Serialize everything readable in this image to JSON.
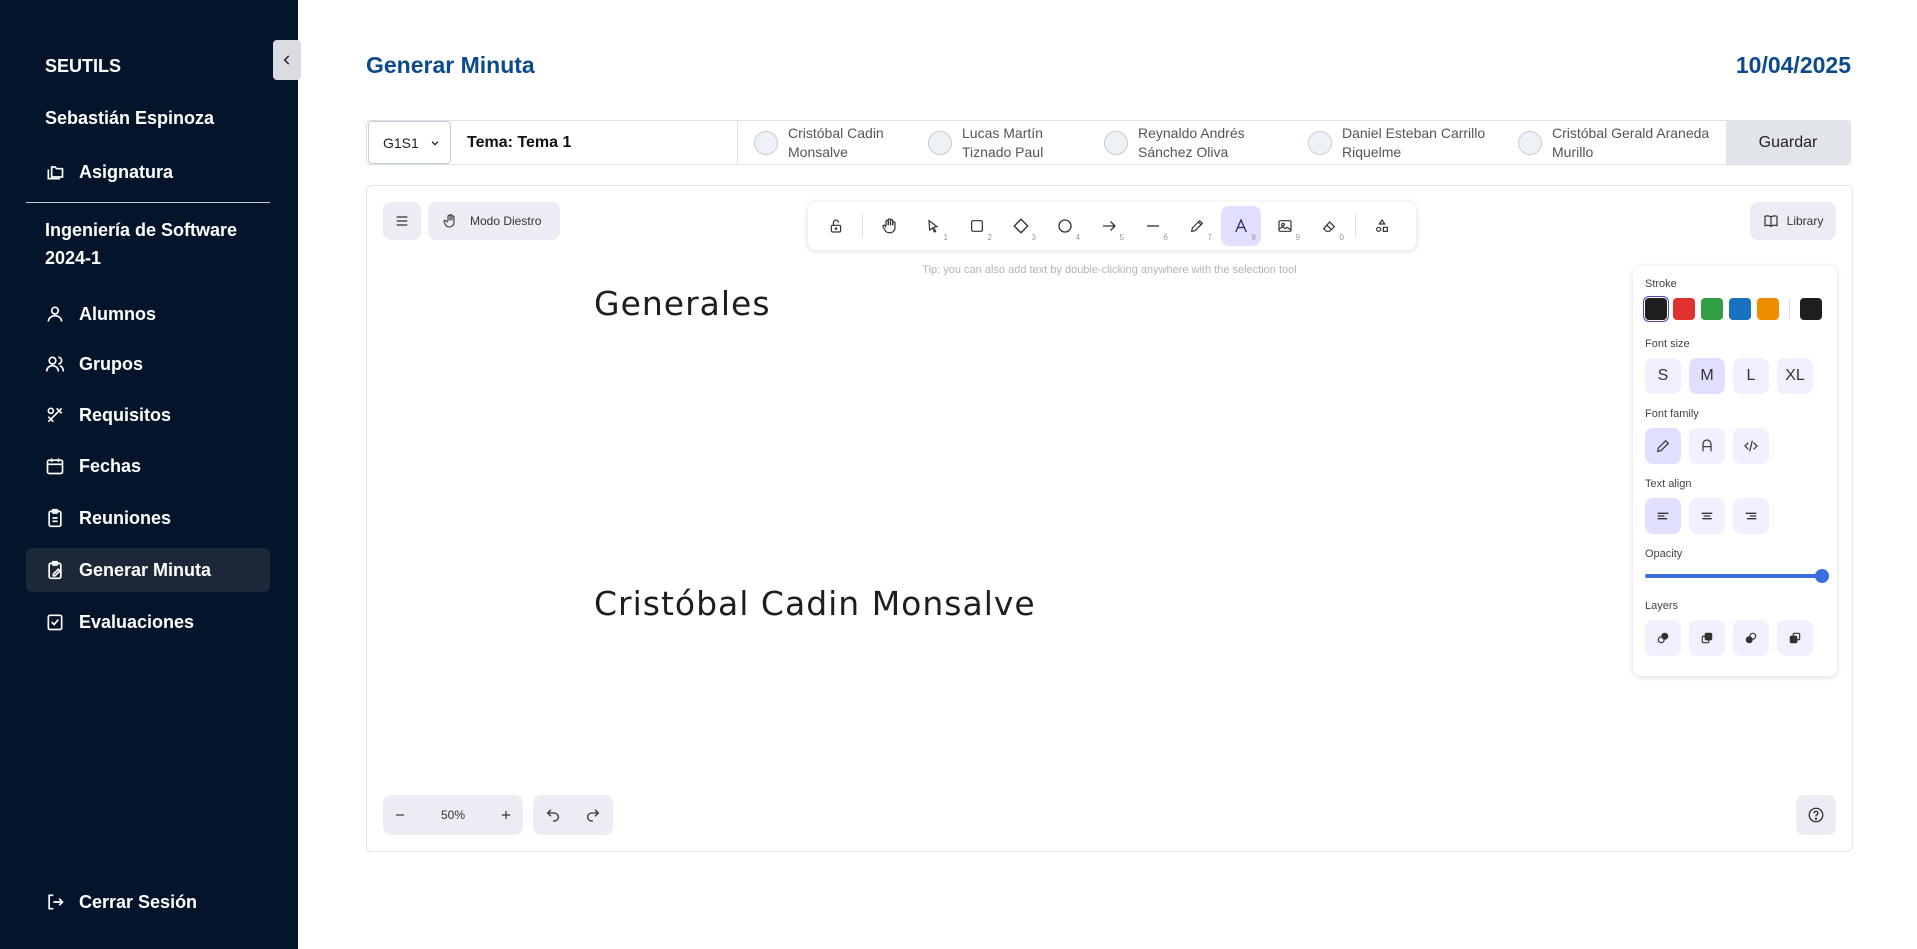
{
  "sidebar": {
    "brand": "SEUTILS",
    "user": "Sebastián Espinoza",
    "subject_label": "Asignatura",
    "course": "Ingeniería de Software 2024-1",
    "items": [
      {
        "label": "Alumnos",
        "icon": "user-icon"
      },
      {
        "label": "Grupos",
        "icon": "users-icon"
      },
      {
        "label": "Requisitos",
        "icon": "tools-icon"
      },
      {
        "label": "Fechas",
        "icon": "calendar-icon"
      },
      {
        "label": "Reuniones",
        "icon": "clipboard-icon"
      },
      {
        "label": "Generar Minuta",
        "icon": "clipboard-edit-icon",
        "active": true
      },
      {
        "label": "Evaluaciones",
        "icon": "check-square-icon"
      }
    ],
    "logout": "Cerrar Sesión"
  },
  "header": {
    "title": "Generar Minuta",
    "date": "10/04/2025"
  },
  "attendance": {
    "group_value": "G1S1",
    "tema": "Tema: Tema 1",
    "students": [
      {
        "line1": "Cristóbal Cadin",
        "line2": "Monsalve"
      },
      {
        "line1": "Lucas Martín",
        "line2": "Tiznado Paul"
      },
      {
        "line1": "Reynaldo Andrés",
        "line2": "Sánchez Oliva"
      },
      {
        "line1": "Daniel Esteban Carrillo",
        "line2": "Riquelme"
      },
      {
        "line1": "Cristóbal Gerald Araneda",
        "line2": "Murillo"
      }
    ],
    "save_label": "Guardar"
  },
  "canvas": {
    "mode_label": "Modo Diestro",
    "library_label": "Library",
    "tip": "Tip: you can also add text by double-clicking anywhere with the selection tool",
    "tools": [
      {
        "name": "lock-icon",
        "key": ""
      },
      {
        "name": "hand-icon",
        "key": ""
      },
      {
        "name": "selection-icon",
        "key": "1"
      },
      {
        "name": "rectangle-icon",
        "key": "2"
      },
      {
        "name": "diamond-icon",
        "key": "3"
      },
      {
        "name": "ellipse-icon",
        "key": "4"
      },
      {
        "name": "arrow-icon",
        "key": "5"
      },
      {
        "name": "line-icon",
        "key": "6"
      },
      {
        "name": "pencil-icon",
        "key": "7"
      },
      {
        "name": "text-icon",
        "key": "8",
        "active": true
      },
      {
        "name": "image-icon",
        "key": "9"
      },
      {
        "name": "eraser-icon",
        "key": "0"
      },
      {
        "name": "shapes-icon",
        "key": ""
      }
    ],
    "texts": [
      "Generales",
      "Cristóbal Cadin Monsalve"
    ],
    "zoom": "50%"
  },
  "props": {
    "stroke_label": "Stroke",
    "stroke_colors": [
      "#1e1e1e",
      "#e03131",
      "#2f9e44",
      "#1971c2",
      "#f08c00"
    ],
    "current_stroke": "#1e1e1e",
    "font_size_label": "Font size",
    "font_sizes": [
      "S",
      "M",
      "L",
      "XL"
    ],
    "font_size_selected": "M",
    "font_family_label": "Font family",
    "text_align_label": "Text align",
    "opacity_label": "Opacity",
    "opacity": 100,
    "layers_label": "Layers"
  }
}
